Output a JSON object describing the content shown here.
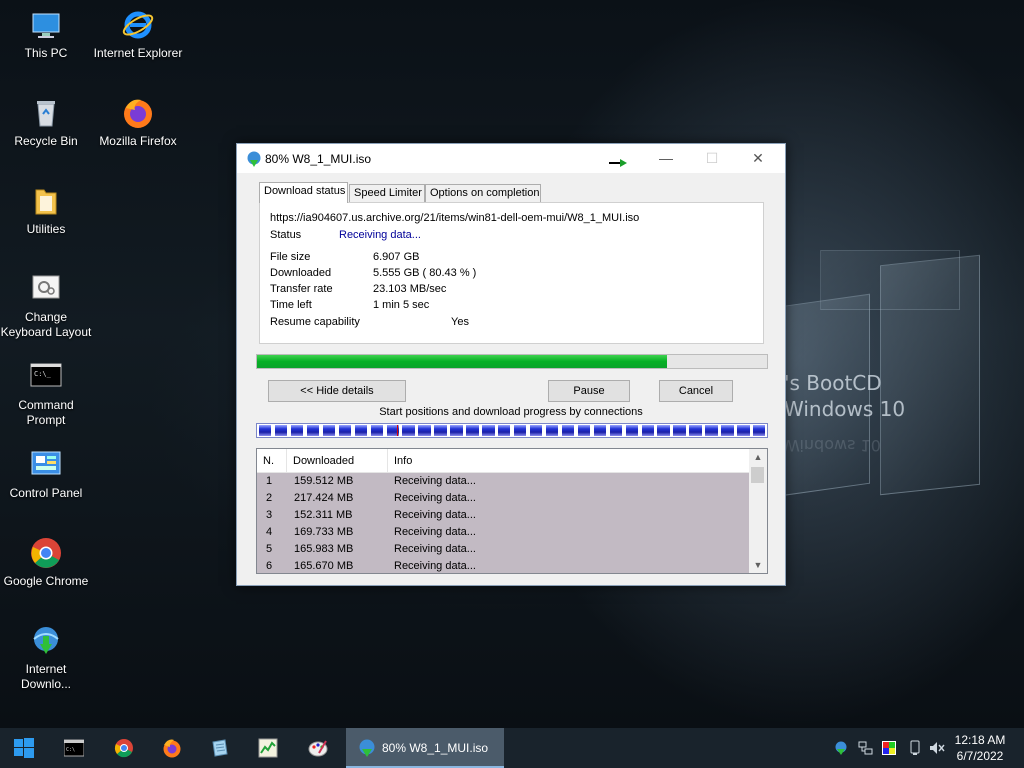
{
  "desktop": {
    "icons": [
      {
        "label": "This PC"
      },
      {
        "label": "Internet Explorer"
      },
      {
        "label": "Recycle Bin"
      },
      {
        "label": "Mozilla Firefox"
      },
      {
        "label": "Utilities"
      },
      {
        "label": "Change Keyboard Layout"
      },
      {
        "label": "Command Prompt"
      },
      {
        "label": "Control Panel"
      },
      {
        "label": "Google Chrome"
      },
      {
        "label": "Internet Downlo..."
      }
    ],
    "wallpaper_text": [
      "'s BootCD",
      "Windows 10"
    ],
    "wallpaper_mirror": "Windows 10"
  },
  "window": {
    "title": "80% W8_1_MUI.iso",
    "tabs": [
      "Download status",
      "Speed Limiter",
      "Options on completion"
    ],
    "url": "https://ia904607.us.archive.org/21/items/win81-dell-oem-mui/W8_1_MUI.iso",
    "status_label": "Status",
    "status_value": "Receiving data...",
    "file_size_label": "File size",
    "file_size_value": "6.907  GB",
    "downloaded_label": "Downloaded",
    "downloaded_value": "5.555  GB  ( 80.43 % )",
    "transfer_rate_label": "Transfer rate",
    "transfer_rate_value": "23.103  MB/sec",
    "time_left_label": "Time left",
    "time_left_value": "1 min 5 sec",
    "resume_label": "Resume capability",
    "resume_value": "Yes",
    "progress_percent": 80.43,
    "buttons": {
      "hide_details": "<< Hide details",
      "pause": "Pause",
      "cancel": "Cancel"
    },
    "connections_caption": "Start positions and download progress by connections",
    "connections_columns": [
      "N.",
      "Downloaded",
      "Info"
    ],
    "connections": [
      {
        "n": "1",
        "downloaded": "159.512  MB",
        "info": "Receiving data..."
      },
      {
        "n": "2",
        "downloaded": "217.424  MB",
        "info": "Receiving data..."
      },
      {
        "n": "3",
        "downloaded": "152.311  MB",
        "info": "Receiving data..."
      },
      {
        "n": "4",
        "downloaded": "169.733  MB",
        "info": "Receiving data..."
      },
      {
        "n": "5",
        "downloaded": "165.983  MB",
        "info": "Receiving data..."
      },
      {
        "n": "6",
        "downloaded": "165.670  MB",
        "info": "Receiving data..."
      }
    ]
  },
  "taskbar": {
    "pinned": [
      "start-icon",
      "command-prompt-icon",
      "chrome-icon",
      "firefox-icon",
      "notepad-icon",
      "task-manager-icon",
      "paint-icon"
    ],
    "active_app_label": "80% W8_1_MUI.iso",
    "tray_icons": [
      "idm-tray-icon",
      "network-icon",
      "color-picker-icon",
      "display-icon",
      "usb-icon",
      "volume-muted-icon"
    ],
    "time": "12:18 AM",
    "date": "6/7/2022"
  },
  "colors": {
    "progress_green": "#06b025",
    "status_blue": "#000099",
    "connection_blue": "#1a1fa8",
    "taskbar_bg": "#19232c"
  }
}
